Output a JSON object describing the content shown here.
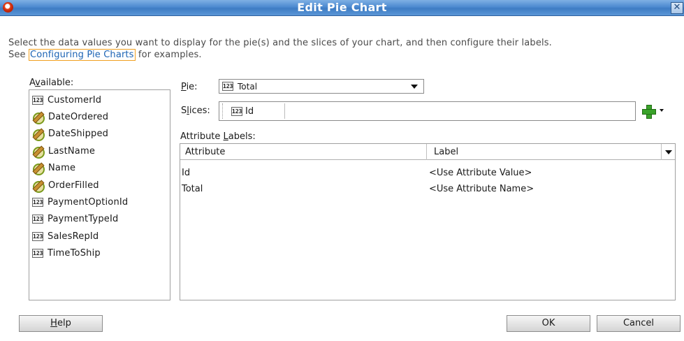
{
  "window": {
    "title": "Edit Pie Chart",
    "close_glyph": "✕"
  },
  "instructions": {
    "line1": "Select the data values you want to display for the pie(s) and the slices of your chart, and then configure their labels.",
    "line2_prefix": "See ",
    "link_text": "Configuring Pie Charts",
    "line2_suffix": " for examples."
  },
  "available": {
    "label_prefix": "A",
    "label_mnemonic": "v",
    "label_suffix": "ailable:",
    "items": [
      {
        "label": "CustomerId",
        "icon": "number-icon"
      },
      {
        "label": "DateOrdered",
        "icon": "attribute-icon"
      },
      {
        "label": "DateShipped",
        "icon": "attribute-icon"
      },
      {
        "label": "LastName",
        "icon": "attribute-icon"
      },
      {
        "label": "Name",
        "icon": "attribute-icon"
      },
      {
        "label": "OrderFilled",
        "icon": "attribute-icon"
      },
      {
        "label": "PaymentOptionId",
        "icon": "number-icon"
      },
      {
        "label": "PaymentTypeId",
        "icon": "number-icon"
      },
      {
        "label": "SalesRepId",
        "icon": "number-icon"
      },
      {
        "label": "TimeToShip",
        "icon": "number-icon"
      }
    ]
  },
  "pie": {
    "label_mnemonic": "P",
    "label_suffix": "ie:",
    "value": "Total",
    "icon_text": "123"
  },
  "slices": {
    "label_prefix": "S",
    "label_mnemonic": "l",
    "label_suffix": "ices:",
    "value": "Id",
    "icon_text": "123"
  },
  "attribute_labels": {
    "title_prefix": "Attribute ",
    "title_mnemonic": "L",
    "title_suffix": "abels:",
    "columns": [
      "Attribute",
      "Label"
    ],
    "rows": [
      {
        "attribute": "Id",
        "label": "<Use Attribute Value>"
      },
      {
        "attribute": "Total",
        "label": "<Use Attribute Name>"
      }
    ]
  },
  "buttons": {
    "help_mnemonic": "H",
    "help_suffix": "elp",
    "ok": "OK",
    "cancel": "Cancel"
  },
  "icon_text": "123",
  "colors": {
    "titlebar": "#4d8ad0",
    "link": "#1c63b4",
    "link_border": "#f0a020",
    "add_green": "#3aa22a"
  }
}
